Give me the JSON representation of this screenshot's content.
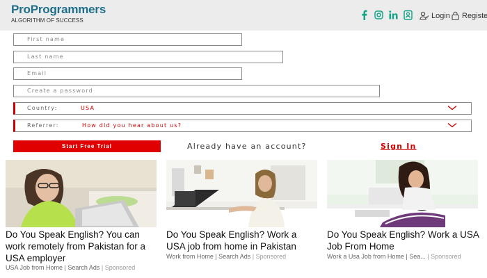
{
  "header": {
    "brand": "ProProgrammers",
    "tagline": "ALGORITHM OF SUCCESS",
    "social_icons": [
      "facebook-icon",
      "instagram-icon",
      "linkedin-icon",
      "contact-icon"
    ],
    "login_label": "Login",
    "register_label": "Register",
    "accent_color": "#17a589"
  },
  "form": {
    "first_name_placeholder": "First name",
    "last_name_placeholder": "Last name",
    "email_placeholder": "Email",
    "password_placeholder": "Create a password",
    "country_label": "Country:",
    "country_value": "USA",
    "referrer_label": "Referrer:",
    "referrer_value": "How did you hear about us?",
    "start_trial_label": "Start Free Trial",
    "already_text": "Already have an account?",
    "signin_label": "Sign In"
  },
  "ads": [
    {
      "title": "Do You Speak English? You can work remotely from Pakistan for a USA employer",
      "source": "USA Job from Home | Search Ads",
      "sponsored": "| Sponsored"
    },
    {
      "title": "Do You Speak English? Work a USA job from home in Pakistan",
      "source": "Work from Home | Search Ads",
      "sponsored": "| Sponsored"
    },
    {
      "title": "Do You Speak English? Work a USA Job From Home",
      "source": "Work a Usa Job from Home | Sea...",
      "sponsored": "| Sponsored"
    }
  ],
  "colors": {
    "brand": "#1f6f8b",
    "cta": "#e00000",
    "link": "#cc0000"
  }
}
